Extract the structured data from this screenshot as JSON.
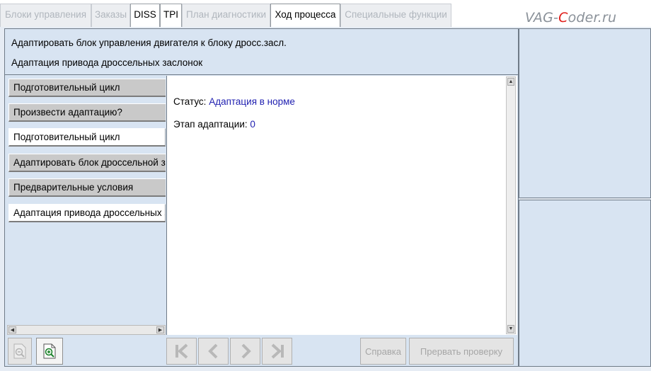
{
  "tabs": [
    {
      "label": "Блоки управления",
      "state": "disabled"
    },
    {
      "label": "Заказы",
      "state": "disabled"
    },
    {
      "label": "DISS",
      "state": "enabled"
    },
    {
      "label": "TPI",
      "state": "enabled"
    },
    {
      "label": "План диагностики",
      "state": "disabled"
    },
    {
      "label": "Ход процесса",
      "state": "active"
    },
    {
      "label": "Специальные функции",
      "state": "disabled"
    }
  ],
  "brand": {
    "prefix": "VAG-",
    "highlight": "C",
    "suffix": "oder.ru"
  },
  "header": {
    "line1": "Адаптировать блок управления двигателя к блоку дросс.засл.",
    "line2": "Адаптация привода дроссельных заслонок"
  },
  "steps": [
    {
      "label": "Подготовительный цикл",
      "style": "grey"
    },
    {
      "label": "Произвести адаптацию?",
      "style": "grey"
    },
    {
      "label": "Подготовительный цикл",
      "style": "white"
    },
    {
      "label": "Адаптировать блок дроссельной заслонки",
      "style": "grey"
    },
    {
      "label": "Предварительные условия",
      "style": "grey"
    },
    {
      "label": "Адаптация привода дроссельных заслонок",
      "style": "white"
    }
  ],
  "content": {
    "status_label": "Статус: ",
    "status_value": "Адаптация в норме",
    "stage_label": "Этап адаптации: ",
    "stage_value": "0"
  },
  "toolbar": {
    "help_label": "Справка",
    "abort_label": "Прервать проверку"
  },
  "colors": {
    "accent_value": "#1f1fb0",
    "brand_red": "#e0201c",
    "panel_bg": "#d8e4f2"
  }
}
